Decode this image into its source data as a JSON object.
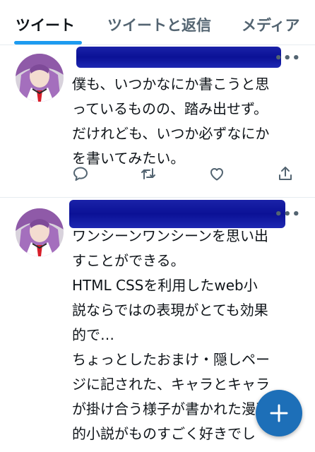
{
  "tabs": [
    {
      "label": "ツイート",
      "active": true
    },
    {
      "label": "ツイートと返信",
      "active": false
    },
    {
      "label": "メディア",
      "active": false
    }
  ],
  "tweets": [
    {
      "text": "僕も、いつかなにか書こうと思\nっているものの、踏み出せず。\nだけれども、いつか必ずなにか\nを書いてみたい。",
      "more_icon": "more-horizontal-icon",
      "actions": [
        "reply-icon",
        "retweet-icon",
        "like-icon",
        "share-icon"
      ]
    },
    {
      "text": "ワンシーンワンシーンを思い出\nすことができる。\nHTML CSSを利用したweb小\n説ならではの表現がとても効果\n的で…\nちょっとしたおまけ・隠しペー\nジに記された、キャラとキャラ\nが掛け合う様子が書かれた漫画\n的小説がものすごく好きでし\nた。",
      "more_icon": "more-horizontal-icon"
    }
  ],
  "colors": {
    "accent": "#1d9bf0",
    "fab": "#1d6fb8",
    "redaction": "#0b1196",
    "secondary_text": "#536471"
  },
  "fab": {
    "icon": "plus-icon"
  }
}
